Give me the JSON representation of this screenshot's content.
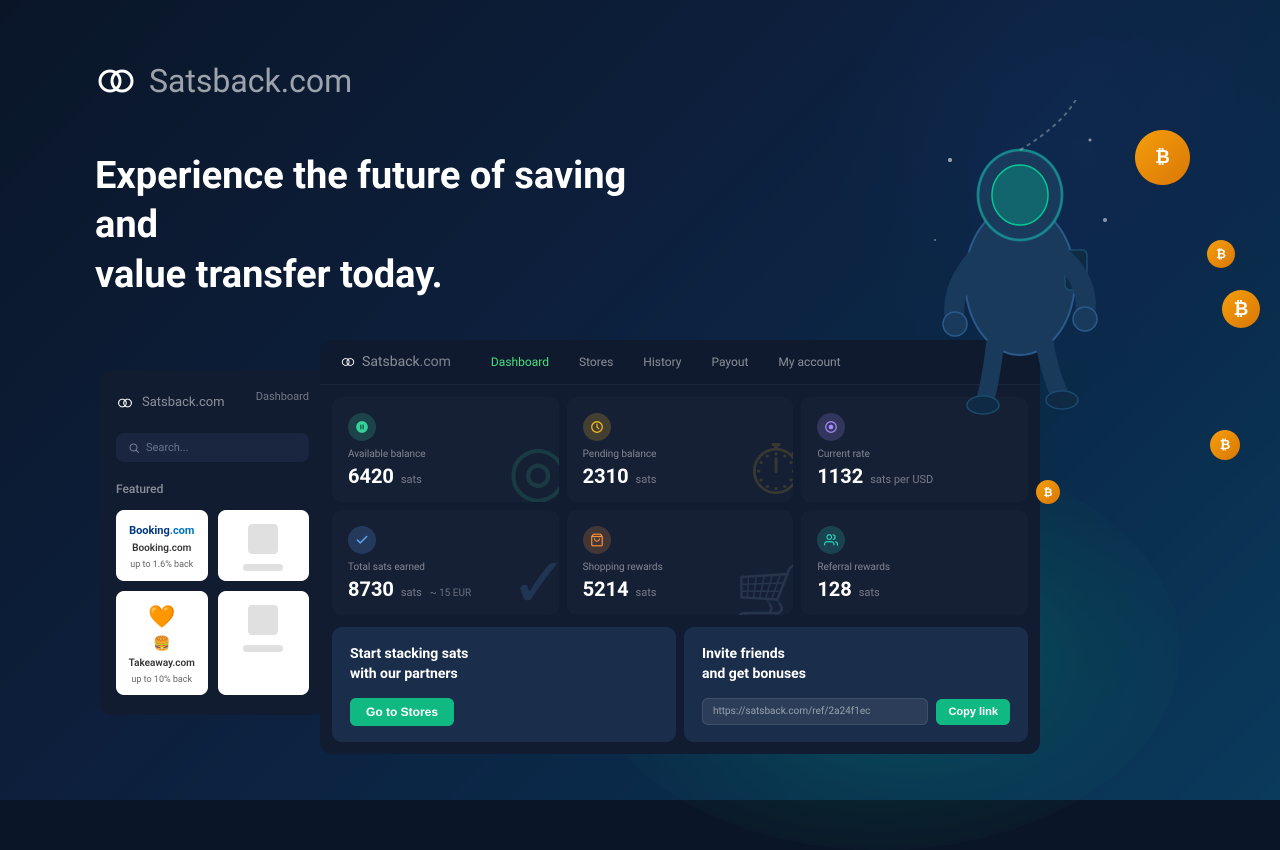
{
  "brand": {
    "logo_text": "Satsback",
    "logo_suffix": ".com",
    "tagline_line1": "Experience the future of saving and",
    "tagline_line2": "value transfer today."
  },
  "nav": {
    "logo_text": "Satsback",
    "logo_suffix": ".com",
    "items": [
      {
        "label": "Dashboard",
        "active": true
      },
      {
        "label": "Stores",
        "active": false
      },
      {
        "label": "History",
        "active": false
      },
      {
        "label": "Payout",
        "active": false
      },
      {
        "label": "My account",
        "active": false
      }
    ]
  },
  "sidebar": {
    "logo_text": "Satsback",
    "logo_suffix": ".com",
    "dashboard_label": "Dashboard",
    "search_placeholder": "Search...",
    "featured_label": "Featured",
    "featured_cards": [
      {
        "name": "Booking.com",
        "back": "up to 1.6% back",
        "type": "booking"
      },
      {
        "name": "",
        "back": "",
        "type": "placeholder"
      },
      {
        "name": "Takeaway.com",
        "back": "up to 10% back",
        "type": "takeaway"
      },
      {
        "name": "",
        "back": "",
        "type": "placeholder"
      }
    ]
  },
  "stats": [
    {
      "id": "available-balance",
      "label": "Available balance",
      "value": "6420",
      "unit": "sats",
      "extra": "",
      "icon": "♻",
      "icon_class": "icon-green"
    },
    {
      "id": "pending-balance",
      "label": "Pending balance",
      "value": "2310",
      "unit": "sats",
      "extra": "",
      "icon": "⏱",
      "icon_class": "icon-yellow"
    },
    {
      "id": "current-rate",
      "label": "Current rate",
      "value": "1132",
      "unit": "sats per USD",
      "extra": "",
      "icon": "◉",
      "icon_class": "icon-purple"
    },
    {
      "id": "total-sats-earned",
      "label": "Total sats earned",
      "value": "8730",
      "unit": "sats",
      "extra": "~ 15 EUR",
      "icon": "✓",
      "icon_class": "icon-blue"
    },
    {
      "id": "shopping-rewards",
      "label": "Shopping rewards",
      "value": "5214",
      "unit": "sats",
      "extra": "",
      "icon": "🛒",
      "icon_class": "icon-orange"
    },
    {
      "id": "referral-rewards",
      "label": "Referral rewards",
      "value": "128",
      "unit": "sats",
      "extra": "",
      "icon": "👥",
      "icon_class": "icon-teal"
    }
  ],
  "cta": {
    "stack_title_line1": "Start stacking sats",
    "stack_title_line2": "with our partners",
    "goto_stores_btn": "Go to Stores",
    "invite_title_line1": "Invite friends",
    "invite_title_line2": "and get bonuses",
    "ref_link": "https://satsback.com/ref/2a24f1ec",
    "copy_btn": "Copy link"
  },
  "coins": [
    {
      "id": "coin-large",
      "symbol": "₿"
    },
    {
      "id": "coin-medium",
      "symbol": "₿"
    },
    {
      "id": "coin-small",
      "symbol": "₿"
    }
  ]
}
